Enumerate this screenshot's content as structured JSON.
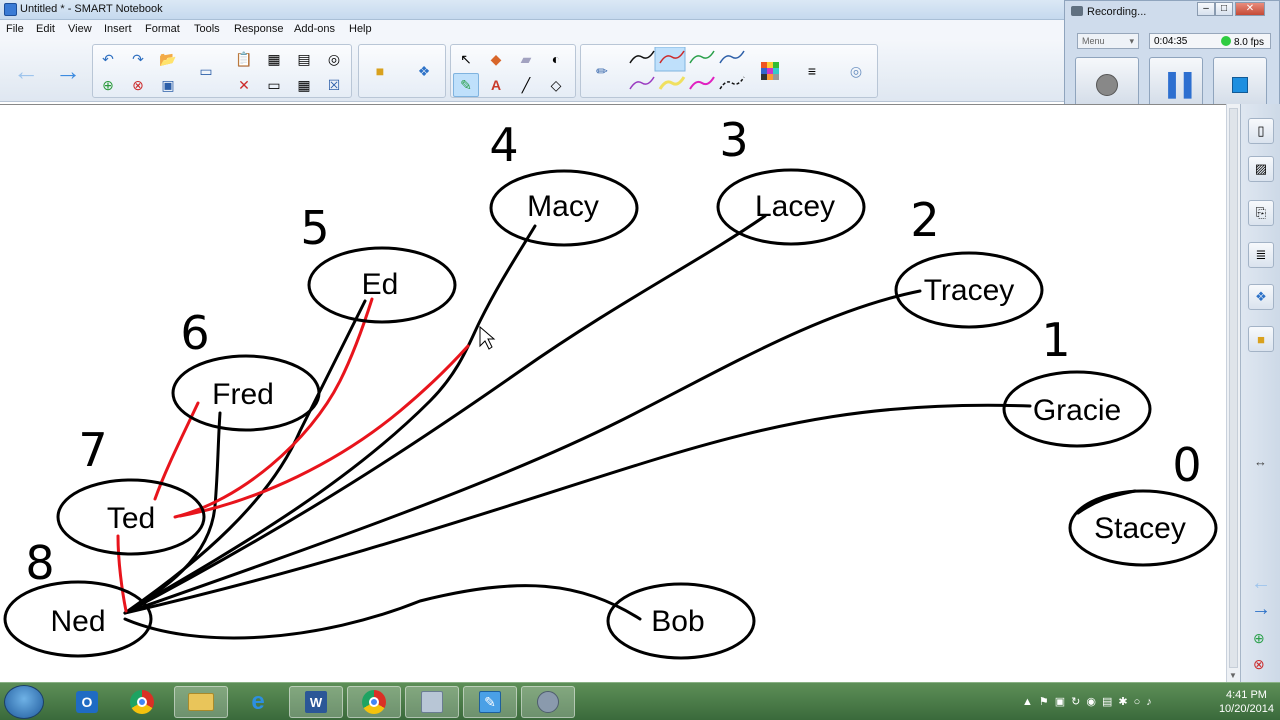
{
  "window": {
    "title": "Untitled * - SMART Notebook"
  },
  "menu": [
    "File",
    "Edit",
    "View",
    "Insert",
    "Format",
    "Tools",
    "Response",
    "Add-ons",
    "Help"
  ],
  "recorder": {
    "title": "Recording...",
    "menu_label": "Menu",
    "elapsed": "0:04:35",
    "fps": "8.0 fps"
  },
  "diagram": {
    "nodes": [
      {
        "name": "Ned",
        "number": "8"
      },
      {
        "name": "Ted",
        "number": "7"
      },
      {
        "name": "Fred",
        "number": "6"
      },
      {
        "name": "Ed",
        "number": "5"
      },
      {
        "name": "Macy",
        "number": "4"
      },
      {
        "name": "Lacey",
        "number": "3"
      },
      {
        "name": "Tracey",
        "number": "2"
      },
      {
        "name": "Gracie",
        "number": "1"
      },
      {
        "name": "Stacey",
        "number": "0"
      },
      {
        "name": "Bob",
        "number": ""
      }
    ],
    "colors": {
      "ink": "#000000",
      "highlight": "#e8141c"
    }
  },
  "taskbar": {
    "time": "4:41 PM",
    "date": "10/20/2014"
  }
}
